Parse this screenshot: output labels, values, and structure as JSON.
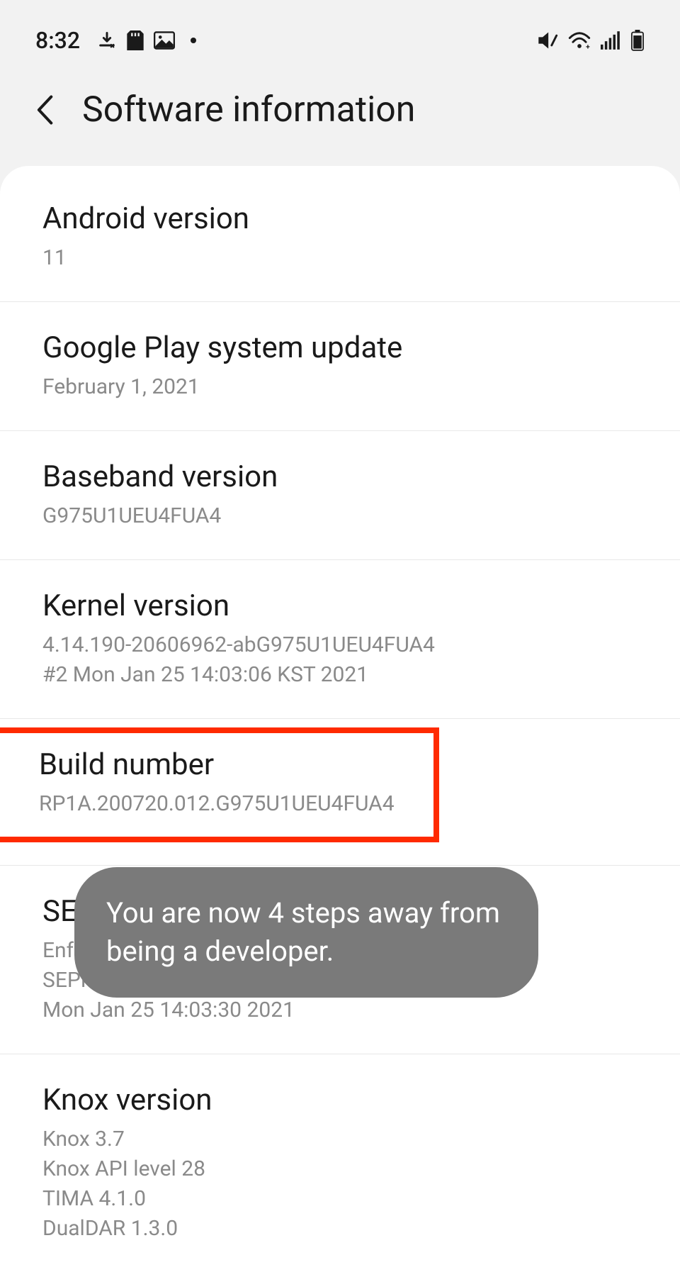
{
  "status": {
    "time": "8:32"
  },
  "header": {
    "title": "Software information"
  },
  "items": {
    "android_version": {
      "title": "Android version",
      "value": "11"
    },
    "google_play": {
      "title": "Google Play system update",
      "value": "February 1, 2021"
    },
    "baseband": {
      "title": "Baseband version",
      "value": "G975U1UEU4FUA4"
    },
    "kernel": {
      "title": "Kernel version",
      "value": "4.14.190-20606962-abG975U1UEU4FUA4\n#2 Mon Jan 25 14:03:06 KST 2021"
    },
    "build": {
      "title": "Build number",
      "value": "RP1A.200720.012.G975U1UEU4FUA4"
    },
    "se_android": {
      "title": "SE for Android status",
      "value": "Enforcing\nSEPF_SM-G975U1_11_0006\nMon Jan 25 14:03:30 2021"
    },
    "knox": {
      "title": "Knox version",
      "value": "Knox 3.7\nKnox API level 28\nTIMA 4.1.0\nDualDAR 1.3.0"
    }
  },
  "toast": {
    "message": "You are now 4 steps away from being a developer."
  }
}
